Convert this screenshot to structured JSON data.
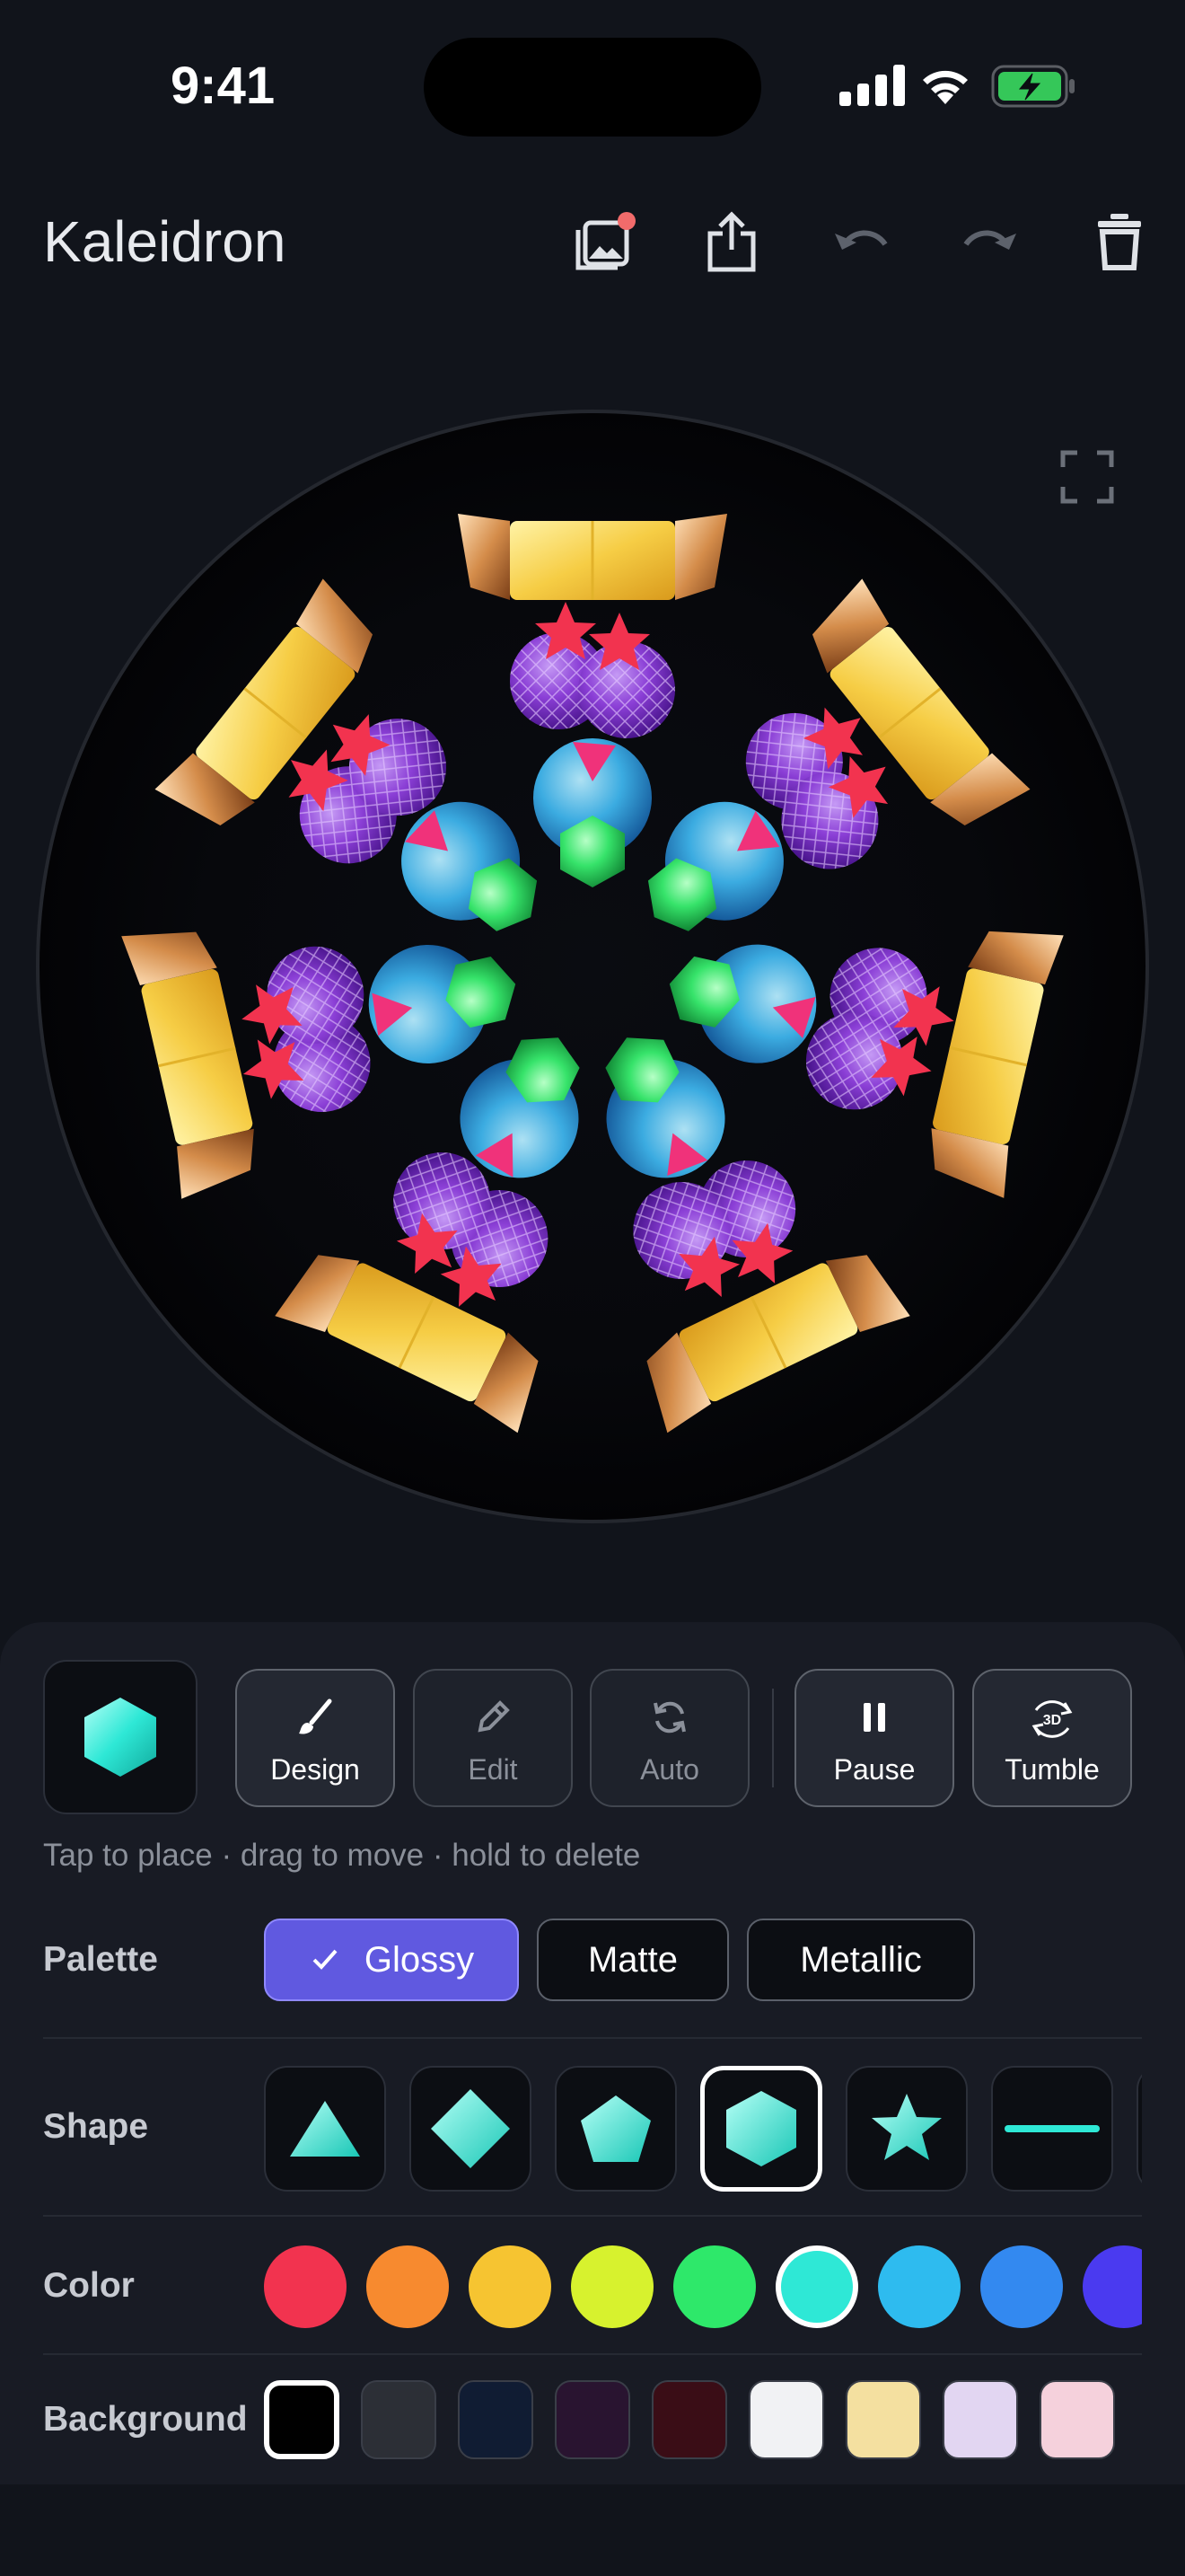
{
  "status": {
    "time": "9:41"
  },
  "app": {
    "title": "Kaleidron"
  },
  "toolbar": {
    "icons": [
      "gallery-icon",
      "share-icon",
      "undo-icon",
      "redo-icon",
      "trash-icon"
    ],
    "gallery_badge_color": "#f26b6b"
  },
  "modes": [
    {
      "label": "Design",
      "icon": "brush-icon",
      "active": true
    },
    {
      "label": "Edit",
      "icon": "pencil-icon",
      "active": false
    },
    {
      "label": "Auto",
      "icon": "refresh-icon",
      "active": false
    },
    {
      "label": "Pause",
      "icon": "pause-icon",
      "active": true
    },
    {
      "label": "Tumble",
      "icon": "rotate-3d-icon",
      "active": true
    }
  ],
  "hint": "Tap to place · drag to move · hold to delete",
  "palette": {
    "label": "Palette",
    "options": [
      "Glossy",
      "Matte",
      "Metallic"
    ],
    "selected": "Glossy",
    "accent": "#6059e0"
  },
  "shape": {
    "label": "Shape",
    "options": [
      "triangle",
      "diamond",
      "pentagon",
      "hexagon",
      "star",
      "line"
    ],
    "selected": "hexagon"
  },
  "color": {
    "label": "Color",
    "options": [
      "#f2334f",
      "#f78a2f",
      "#f6c431",
      "#d7f22e",
      "#2ee86a",
      "#2ee8d6",
      "#2ebbef",
      "#3389f0",
      "#4a3af0"
    ],
    "selected": "#2ee8d6"
  },
  "background": {
    "label": "Background",
    "options": [
      "#000000",
      "#2c2f36",
      "#101c33",
      "#291430",
      "#3a0d16",
      "#f1f2f4",
      "#f4e0a0",
      "#e2d6f2",
      "#f5d1dc"
    ],
    "selected": "#000000"
  }
}
